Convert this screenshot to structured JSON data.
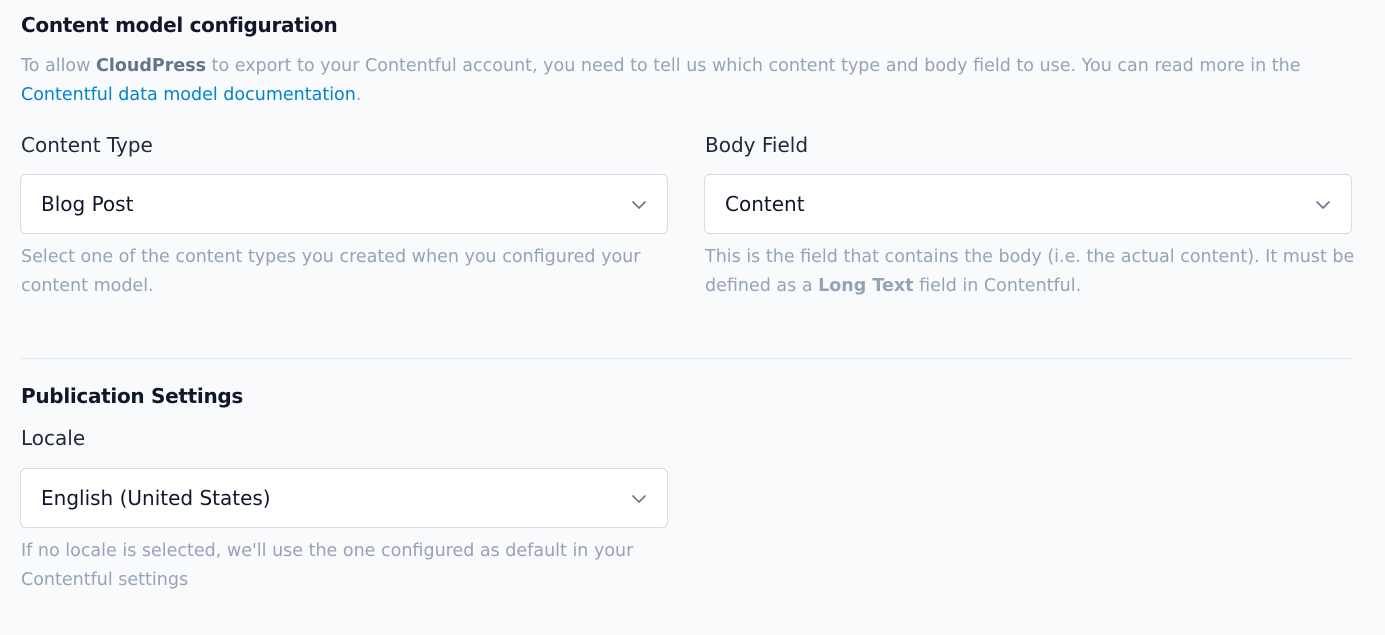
{
  "content_model": {
    "title": "Content model configuration",
    "intro": {
      "part1": "To allow ",
      "brand": "CloudPress",
      "part2": " to export to your Contentful account, you need to tell us which content type and body field to use. You can read more in the ",
      "link_text": "Contentful data model documentation",
      "part3": "."
    },
    "content_type": {
      "label": "Content Type",
      "value": "Blog Post",
      "help": "Select one of the content types you created when you configured your content model."
    },
    "body_field": {
      "label": "Body Field",
      "value": "Content",
      "help_part1": "This is the field that contains the body (i.e. the actual content). It must be defined as a ",
      "help_bold": "Long Text",
      "help_part2": " field in Contentful."
    }
  },
  "publication": {
    "title": "Publication Settings",
    "locale": {
      "label": "Locale",
      "value": "English (United States)",
      "help": "If no locale is selected, we'll use the one configured as default in your Contentful settings"
    }
  },
  "icons": {
    "select_chevron": "chevron-down-icon"
  },
  "colors": {
    "background": "#f8fafc",
    "link": "#0284c7",
    "muted_text": "#94a3b8",
    "border": "#d7dde5"
  }
}
